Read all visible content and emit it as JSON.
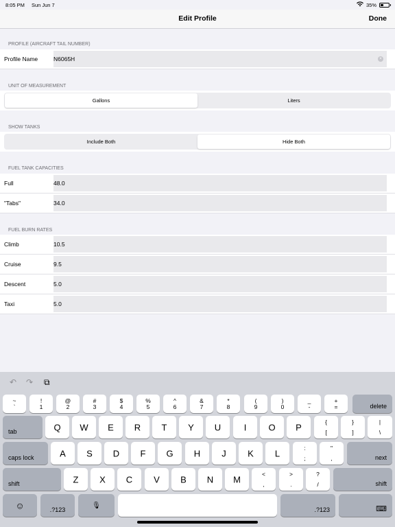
{
  "status": {
    "time": "8:05 PM",
    "date": "Sun Jun 7",
    "battery_text": "35%",
    "battery_level": 0.35
  },
  "nav": {
    "title": "Edit Profile",
    "done_label": "Done"
  },
  "profile": {
    "header": "PROFILE (AIRCRAFT TAIL NUMBER)",
    "label": "Profile Name",
    "value": "N6065H"
  },
  "units": {
    "header": "UNIT OF MEASUREMENT",
    "options": [
      "Gallons",
      "Liters"
    ],
    "selected": "Gallons"
  },
  "tanks": {
    "header": "SHOW TANKS",
    "options": [
      "Include Both",
      "Hide Both"
    ],
    "selected": "Hide Both"
  },
  "capacities": {
    "header": "FUEL TANK CAPACITIES",
    "rows": [
      {
        "label": "Full",
        "value": "48.0"
      },
      {
        "label": "\"Tabs\"",
        "value": "34.0"
      }
    ]
  },
  "burn": {
    "header": "FUEL BURN RATES",
    "rows": [
      {
        "label": "Climb",
        "value": "10.5"
      },
      {
        "label": "Cruise",
        "value": "9.5"
      },
      {
        "label": "Descent",
        "value": "5.0"
      },
      {
        "label": "Taxi",
        "value": "5.0"
      }
    ]
  },
  "keyboard": {
    "toolbar": {
      "undo": "↶",
      "redo": "↷",
      "paste": "⧉"
    },
    "row1": [
      [
        "~",
        "`"
      ],
      [
        "!",
        "1"
      ],
      [
        "@",
        "2"
      ],
      [
        "#",
        "3"
      ],
      [
        "$",
        "4"
      ],
      [
        "%",
        "5"
      ],
      [
        "^",
        "6"
      ],
      [
        "&",
        "7"
      ],
      [
        "*",
        "8"
      ],
      [
        "(",
        "9"
      ],
      [
        ")",
        "0"
      ],
      [
        "_",
        "-"
      ],
      [
        "+",
        "="
      ]
    ],
    "delete": "delete",
    "tab": "tab",
    "row2": [
      "Q",
      "W",
      "E",
      "R",
      "T",
      "Y",
      "U",
      "I",
      "O",
      "P"
    ],
    "row2_extra": [
      [
        "{",
        "["
      ],
      [
        "}",
        "]"
      ],
      [
        "|",
        "\\"
      ]
    ],
    "caps": "caps lock",
    "row3": [
      "A",
      "S",
      "D",
      "F",
      "G",
      "H",
      "J",
      "K",
      "L"
    ],
    "row3_extra": [
      [
        ":",
        ";"
      ],
      [
        "\"",
        ","
      ]
    ],
    "next": "next",
    "shift": "shift",
    "row4": [
      "Z",
      "X",
      "C",
      "V",
      "B",
      "N",
      "M"
    ],
    "row4_extra": [
      [
        "<",
        ","
      ],
      [
        ">",
        "."
      ],
      [
        "?",
        "/"
      ]
    ],
    "emoji": "☺",
    "num": ".?123",
    "mic": "🎙",
    "hide": "⌨"
  }
}
